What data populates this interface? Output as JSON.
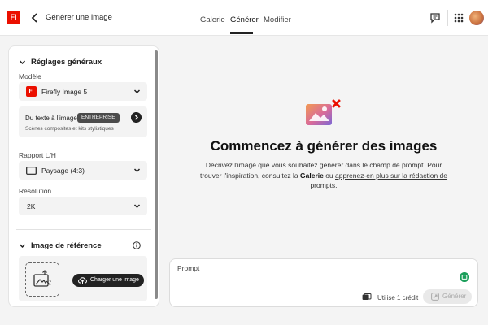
{
  "header": {
    "logo_text": "Fi",
    "back_icon": "chevron-left-icon",
    "title": "Générer une image",
    "tabs": [
      {
        "label": "Galerie",
        "active": false
      },
      {
        "label": "Générer",
        "active": true
      },
      {
        "label": "Modifier",
        "active": false
      }
    ],
    "icons": [
      "chat-icon",
      "apps-grid-icon",
      "avatar"
    ]
  },
  "left_panel": {
    "general_settings": {
      "heading": "Réglages généraux",
      "model": {
        "label": "Modèle",
        "value": "Firefly Image 5",
        "icon_text": "Fi"
      },
      "text_to_image": {
        "title": "Du texte à l'image",
        "badge": "ENTREPRISE",
        "subtitle": "Scènes composites et kits stylistiques"
      },
      "aspect_ratio": {
        "label": "Rapport L/H",
        "value": "Paysage (4:3)"
      },
      "resolution": {
        "label": "Résolution",
        "value": "2K"
      }
    },
    "reference_image": {
      "heading": "Image de référence",
      "upload_button": "Charger une image"
    }
  },
  "main": {
    "headline": "Commencez à générer des images",
    "description": {
      "part1": "Décrivez l'image que vous souhaitez générer dans le champ de prompt. Pour trouver l'inspiration, consultez la ",
      "gallery_link": "Galerie",
      "part2": " ou ",
      "learn_link": "apprenez-en plus sur la rédaction de prompts",
      "part3": "."
    },
    "prompt": {
      "label": "Prompt",
      "value": "",
      "credit_text": "Utilise 1 crédit",
      "generate_button": "Générer"
    }
  },
  "colors": {
    "brand_red": "#eb1000",
    "text_dark": "#222222",
    "panel_bg": "#ffffff",
    "page_bg": "#f4f4f4",
    "field_bg": "#f3f3f3"
  }
}
